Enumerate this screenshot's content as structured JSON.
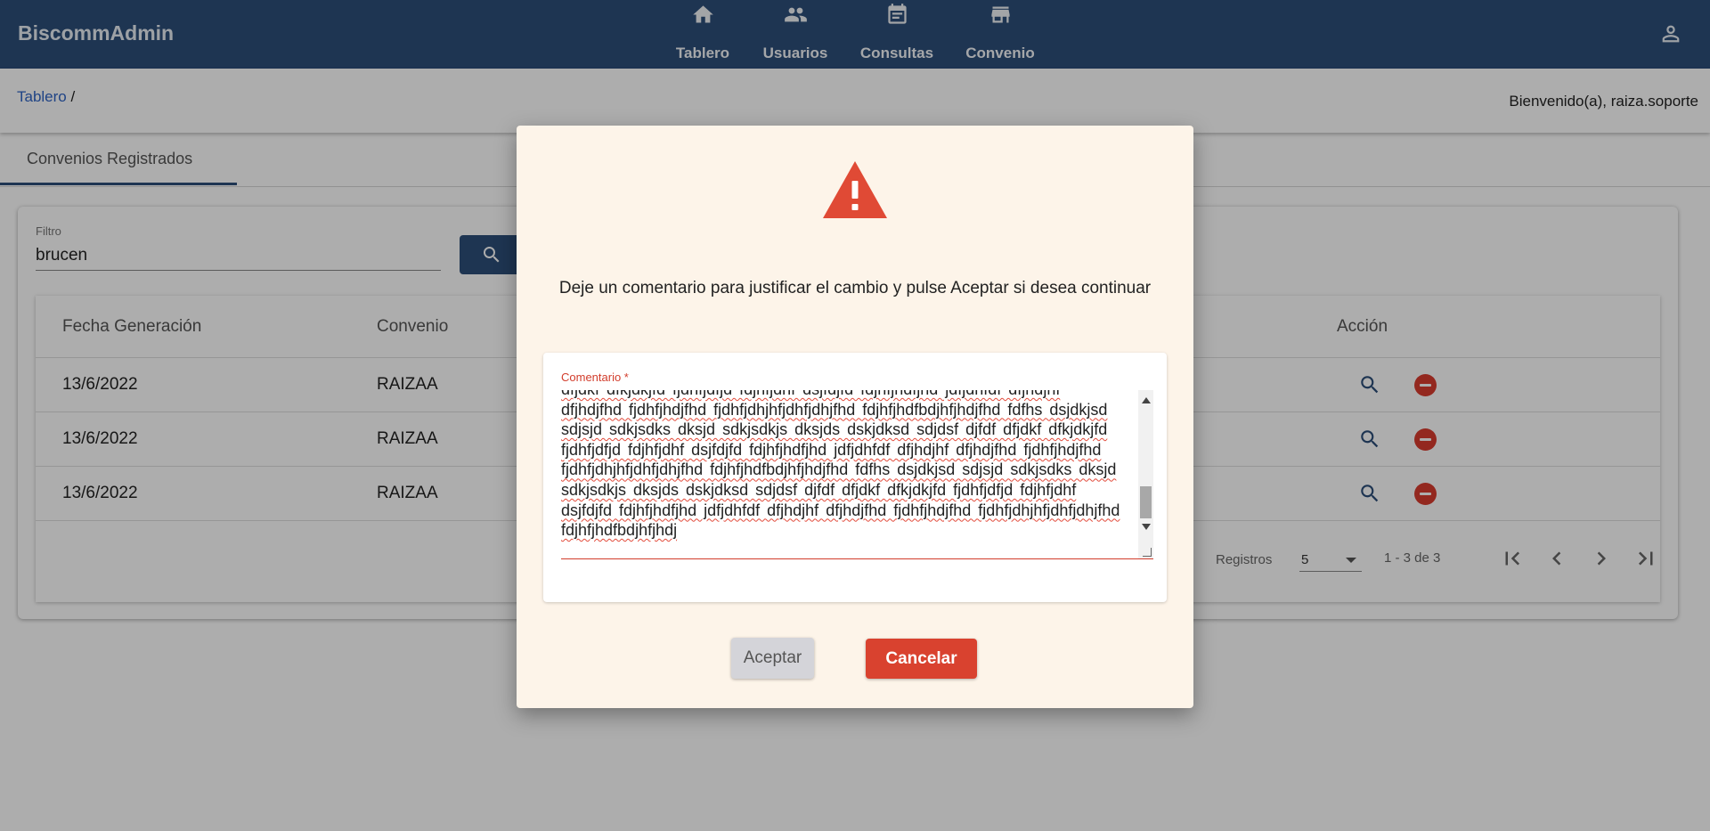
{
  "app": {
    "title": "BiscommAdmin"
  },
  "nav": {
    "items": [
      {
        "label": "Tablero",
        "icon": "home-icon"
      },
      {
        "label": "Usuarios",
        "icon": "people-icon"
      },
      {
        "label": "Consultas",
        "icon": "calendar-icon"
      },
      {
        "label": "Convenio",
        "icon": "store-icon"
      }
    ],
    "user_icon": "account-icon"
  },
  "breadcrumb": {
    "link": "Tablero",
    "separator": " /"
  },
  "welcome": "Bienvenido(a), raiza.soporte",
  "tabs": [
    {
      "label": "Convenios Registrados",
      "active": true
    }
  ],
  "filter": {
    "label": "Filtro",
    "value": "brucen"
  },
  "table": {
    "columns": [
      "Fecha Generación",
      "Convenio",
      "Acción"
    ],
    "rows": [
      {
        "fecha": "13/6/2022",
        "convenio": "RAIZAA"
      },
      {
        "fecha": "13/6/2022",
        "convenio": "RAIZAA"
      },
      {
        "fecha": "13/6/2022",
        "convenio": "RAIZAA"
      }
    ]
  },
  "pagination": {
    "label": "Registros",
    "page_size": "5",
    "range": "1 - 3 de 3"
  },
  "dialog": {
    "message": "Deje un comentario para justificar el cambio y pulse Aceptar si desea continuar",
    "comment_label": "Comentario *",
    "comment_value": "dfjdkf dfkjdkjfd fjdhfjdfjd fdjhfjdhf dsjfdjfd fdjhfjhdfjhd jdfjdhfdf dfjhdjhf dfjhdjfhd fjdhfjhdjfhd fjdhfjdhjhfjdhfjdhjfhd fdjhfjhdfbdjhfjhdjfhd fdfhs dsjdkjsd sdjsjd sdkjsdks dksjd sdkjsdkjs dksjds dskjdksd sdjdsf djfdf dfjdkf dfkjdkjfd fjdhfjdfjd fdjhfjdhf dsjfdjfd fdjhfjhdfjhd jdfjdhfdf dfjhdjhf dfjhdjfhd fjdhfjhdjfhd fjdhfjdhjhfjdhfjdhjfhd fdjhfjhdfbdjhfjhdjfhd fdfhs dsjdkjsd sdjsjd sdkjsdks dksjd sdkjsdkjs dksjds dskjdksd sdjdsf djfdf dfjdkf dfkjdkjfd fjdhfjdfjd fdjhfjdhf dsjfdjfd fdjhfjhdfjhd jdfjdhfdf dfjhdjhf dfjhdjfhd fjdhfjhdjfhd fjdhfjdhjhfjdhfjdhjfhd fdjhfjhdfbdjhfjhdj",
    "accept_label": "Aceptar",
    "cancel_label": "Cancelar"
  },
  "colors": {
    "primary": "#2d4e7a",
    "danger": "#d9422f",
    "dialog_bg": "#fdf4e9"
  }
}
